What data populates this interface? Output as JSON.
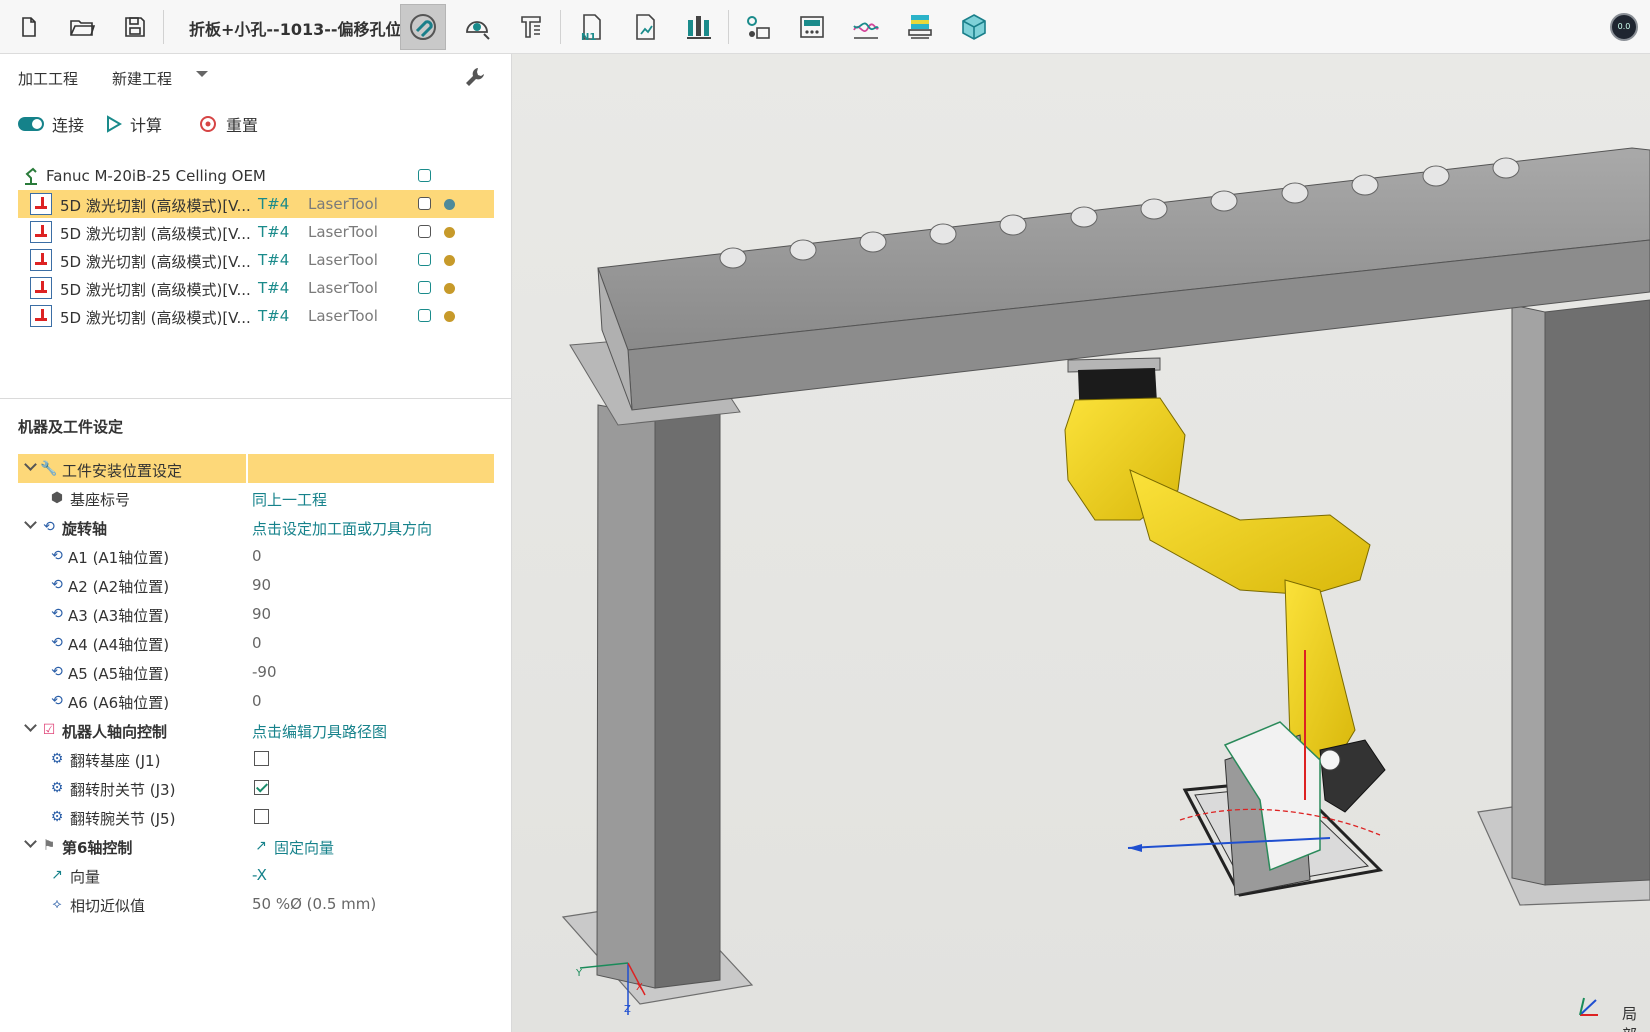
{
  "toolbar": {
    "project_title": "折板+小孔--1013--偏移孔位",
    "status_indicator": "0.0"
  },
  "project": {
    "label": "加工工程",
    "selected": "新建工程"
  },
  "actions": {
    "connect": "连接",
    "compute": "计算",
    "reset": "重置"
  },
  "tree": {
    "robot": "Fanuc M-20iB-25 Celling OEM",
    "operations": [
      {
        "name": "5D 激光切割 (高级模式)[V...",
        "tool": "T#4",
        "type": "LaserTool",
        "dot": "#4e8a9a"
      },
      {
        "name": "5D 激光切割 (高级模式)[V...",
        "tool": "T#4",
        "type": "LaserTool",
        "dot": "#c79a2a"
      },
      {
        "name": "5D 激光切割 (高级模式)[V...",
        "tool": "T#4",
        "type": "LaserTool",
        "dot": "#c79a2a"
      },
      {
        "name": "5D 激光切割 (高级模式)[V...",
        "tool": "T#4",
        "type": "LaserTool",
        "dot": "#c79a2a"
      },
      {
        "name": "5D 激光切割 (高级模式)[V...",
        "tool": "T#4",
        "type": "LaserTool",
        "dot": "#c79a2a"
      }
    ]
  },
  "settings": {
    "title": "机器及工件设定",
    "workpiece_group": "工件安装位置设定",
    "base_label": "基座标号",
    "base_value": "同上一工程",
    "rotary_group": "旋转轴",
    "rotary_value": "点击设定加工面或刀具方向",
    "axes": [
      {
        "label": "A1 (A1轴位置)",
        "value": "0"
      },
      {
        "label": "A2 (A2轴位置)",
        "value": "90"
      },
      {
        "label": "A3 (A3轴位置)",
        "value": "90"
      },
      {
        "label": "A4 (A4轴位置)",
        "value": "0"
      },
      {
        "label": "A5 (A5轴位置)",
        "value": "-90"
      },
      {
        "label": "A6 (A6轴位置)",
        "value": "0"
      }
    ],
    "robot_axis_group": "机器人轴向控制",
    "robot_axis_value": "点击编辑刀具路径图",
    "flips": [
      {
        "label": "翻转基座 (J1)",
        "checked": false
      },
      {
        "label": "翻转肘关节 (J3)",
        "checked": true
      },
      {
        "label": "翻转腕关节 (J5)",
        "checked": false
      }
    ],
    "axis6_group": "第6轴控制",
    "axis6_value": "固定向量",
    "vector_label": "向量",
    "vector_value": "-X",
    "tangent_label": "相切近似值",
    "tangent_value": "50 %Ø (0.5 mm)"
  },
  "viewport": {
    "axis_x": "X",
    "axis_y": "Y",
    "axis_z": "Z",
    "corner_label": "局部"
  },
  "colors": {
    "accent": "#16828b",
    "selection": "#fdd879",
    "robot": "#f2d21a",
    "frame": "#8d8d8d"
  }
}
